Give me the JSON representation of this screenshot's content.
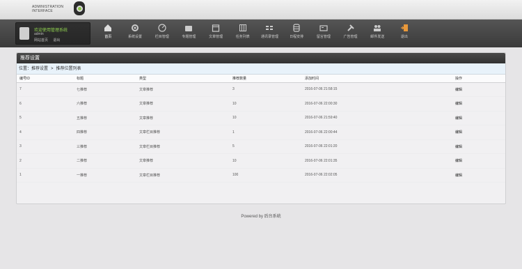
{
  "logo": {
    "line1": "ADMINISTRATION",
    "line2": "INTERFACE"
  },
  "user": {
    "welcome": "欢迎使用管理系统",
    "name": "admin",
    "link_home": "网站首页",
    "link_logout": "退出"
  },
  "nav": [
    {
      "label": "首页",
      "icon": "home-icon"
    },
    {
      "label": "系统设置",
      "icon": "gear-icon"
    },
    {
      "label": "栏目管理",
      "icon": "dashboard-icon"
    },
    {
      "label": "专题管理",
      "icon": "folder-icon"
    },
    {
      "label": "文章管理",
      "icon": "calendar-icon"
    },
    {
      "label": "任务列表",
      "icon": "grid-icon"
    },
    {
      "label": "通讯录管理",
      "icon": "list-icon"
    },
    {
      "label": "日程安排",
      "icon": "database-icon"
    },
    {
      "label": "留言管理",
      "icon": "card-icon"
    },
    {
      "label": "广告管理",
      "icon": "tools-icon"
    },
    {
      "label": "邮件发送",
      "icon": "users-icon"
    },
    {
      "label": "退出",
      "icon": "exit-icon"
    }
  ],
  "panel": {
    "title": "推荐设置",
    "breadcrumb": {
      "prefix": "位置：",
      "level1": "推荐设置",
      "level2": "推荐位置列表"
    }
  },
  "table": {
    "columns": [
      "编号ID",
      "标题",
      "类型",
      "推荐数量",
      "添加时间",
      "操作"
    ],
    "rows": [
      {
        "id": "7",
        "title": "七推荐",
        "type": "文章推荐",
        "count": "3",
        "time": "2016-07-06 21:58:15",
        "action": "编辑"
      },
      {
        "id": "6",
        "title": "六推荐",
        "type": "文章推荐",
        "count": "10",
        "time": "2016-07-06 22:00:30",
        "action": "编辑"
      },
      {
        "id": "5",
        "title": "五推荐",
        "type": "文章推荐",
        "count": "10",
        "time": "2016-07-06 21:59:40",
        "action": "编辑"
      },
      {
        "id": "4",
        "title": "四推荐",
        "type": "文章栏目推荐",
        "count": "1",
        "time": "2016-07-06 22:00:44",
        "action": "编辑"
      },
      {
        "id": "3",
        "title": "三推荐",
        "type": "文章栏目推荐",
        "count": "5",
        "time": "2016-07-06 22:01:20",
        "action": "编辑"
      },
      {
        "id": "2",
        "title": "二推荐",
        "type": "文章推荐",
        "count": "10",
        "time": "2016-07-06 22:01:35",
        "action": "编辑"
      },
      {
        "id": "1",
        "title": "一推荐",
        "type": "文章栏目推荐",
        "count": "100",
        "time": "2016-07-06 22:02:05",
        "action": "编辑"
      }
    ]
  },
  "footer": {
    "text": "Powered by 后台系统"
  }
}
